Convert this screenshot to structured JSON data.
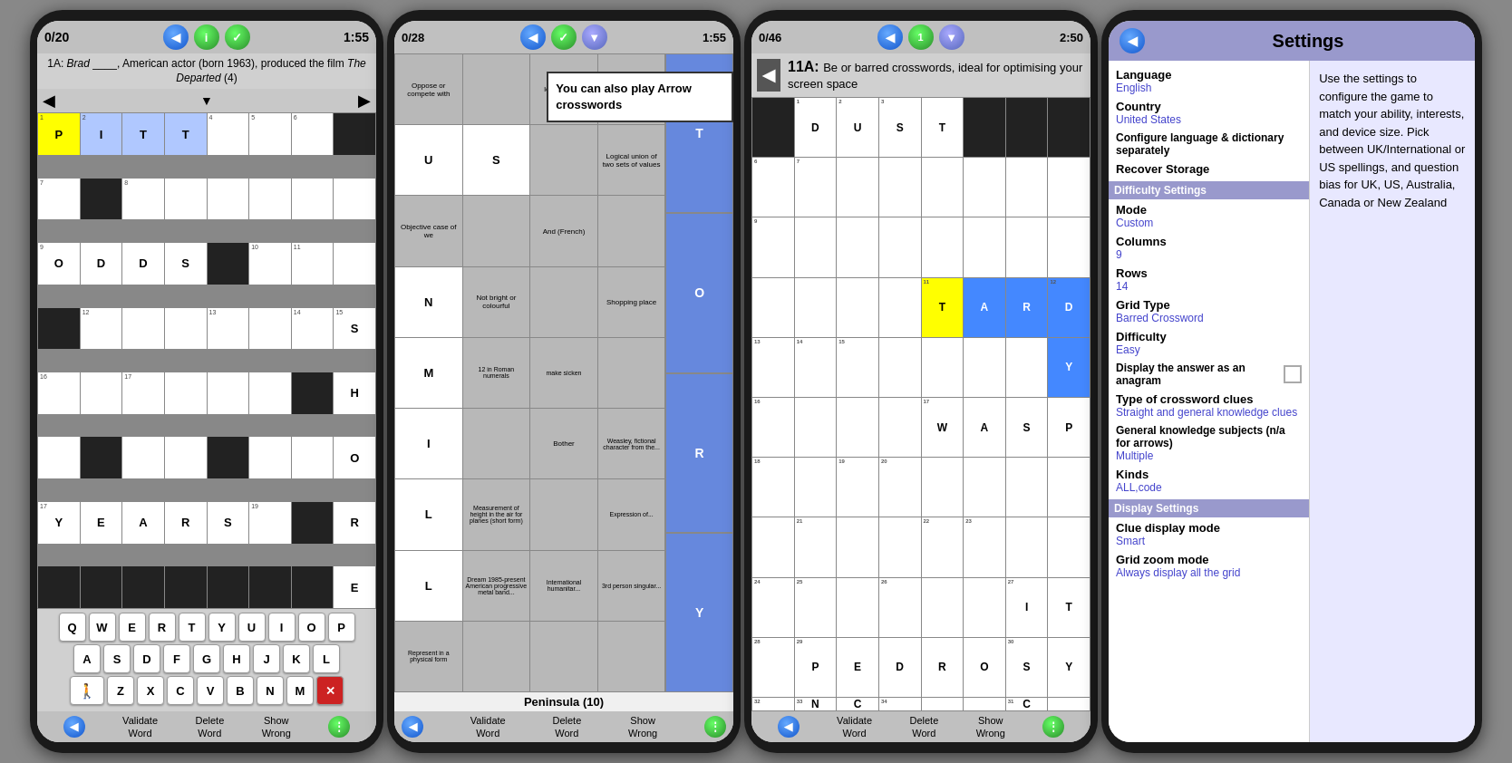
{
  "screen1": {
    "score": "0/20",
    "timer": "1:55",
    "clue": "1A: Brad ____, American actor (born 1963), produced the film The Departed (4)",
    "clue_number": "1A:",
    "clue_plain": "Brad ____, American actor (born 1963), produced the film ",
    "clue_italic": "The Departed",
    "clue_num_parens": " (4)",
    "word_answer": [
      "P",
      "I",
      "T",
      "T"
    ],
    "grid_cols": 8,
    "bottom_buttons": [
      "Validate\nWord",
      "Delete\nWord",
      "Show\nWrong"
    ],
    "keyboard_rows": [
      [
        "Q",
        "W",
        "E",
        "R",
        "T",
        "Y",
        "U",
        "I",
        "O",
        "P"
      ],
      [
        "A",
        "S",
        "D",
        "F",
        "G",
        "H",
        "J",
        "K",
        "L"
      ],
      [
        "Z",
        "X",
        "C",
        "V",
        "B",
        "N",
        "M",
        "⌫"
      ]
    ]
  },
  "screen2": {
    "score": "0/28",
    "timer": "1:55",
    "overlay_text": "You can also play Arrow crosswords",
    "peninsula_label": "Peninsula (10)",
    "bottom_buttons": [
      "Validate\nWord",
      "Delete\nWord",
      "Show\nWrong"
    ]
  },
  "screen3": {
    "score": "0/46",
    "timer": "2:50",
    "clue_ref": "11A:",
    "clue_desc": "Be or barred crosswords, ideal for optimising your screen space",
    "bottom_buttons": [
      "Validate\nWord",
      "Delete\nWord",
      "Show\nWrong"
    ],
    "grid_words": {
      "dust": [
        "D",
        "U",
        "S",
        "T"
      ],
      "tardy": [
        "T",
        "A",
        "R",
        "D",
        "Y"
      ],
      "wasp": [
        "W",
        "A",
        "S",
        "P"
      ],
      "pedro": [
        "P",
        "E",
        "D",
        "R",
        "O"
      ],
      "sync": [
        "S",
        "Y",
        "N",
        "C"
      ]
    }
  },
  "screen4": {
    "title": "Settings",
    "back_label": "←",
    "help_text": "Use the settings to configure the game to match your ability, interests, and device size. Pick between UK/International or US spellings, and question bias for UK, US, Australia, Canada or New Zealand",
    "sections": {
      "general": {
        "language_label": "Language",
        "language_value": "English",
        "country_label": "Country",
        "country_value": "United States",
        "configure_label": "Configure language & dictionary separately",
        "recover_label": "Recover Storage"
      },
      "difficulty_header": "Difficulty Settings",
      "difficulty": {
        "mode_label": "Mode",
        "mode_value": "Custom",
        "columns_label": "Columns",
        "columns_value": "9",
        "rows_label": "Rows",
        "rows_value": "14",
        "grid_type_label": "Grid Type",
        "grid_type_value": "Barred Crossword",
        "difficulty_label": "Difficulty",
        "difficulty_value": "Easy",
        "anagram_label": "Display the answer as an anagram"
      },
      "clues": {
        "type_label": "Type of crossword clues",
        "type_value": "Straight and general knowledge clues",
        "general_label": "General knowledge subjects (n/a for arrows)",
        "general_value": "Multiple",
        "kinds_label": "Kinds",
        "kinds_value": "ALL,code"
      },
      "display_header": "Display Settings",
      "display": {
        "clue_mode_label": "Clue display mode",
        "clue_mode_value": "Smart",
        "grid_zoom_label": "Grid zoom mode",
        "grid_zoom_value": "Always display all the grid"
      }
    }
  }
}
